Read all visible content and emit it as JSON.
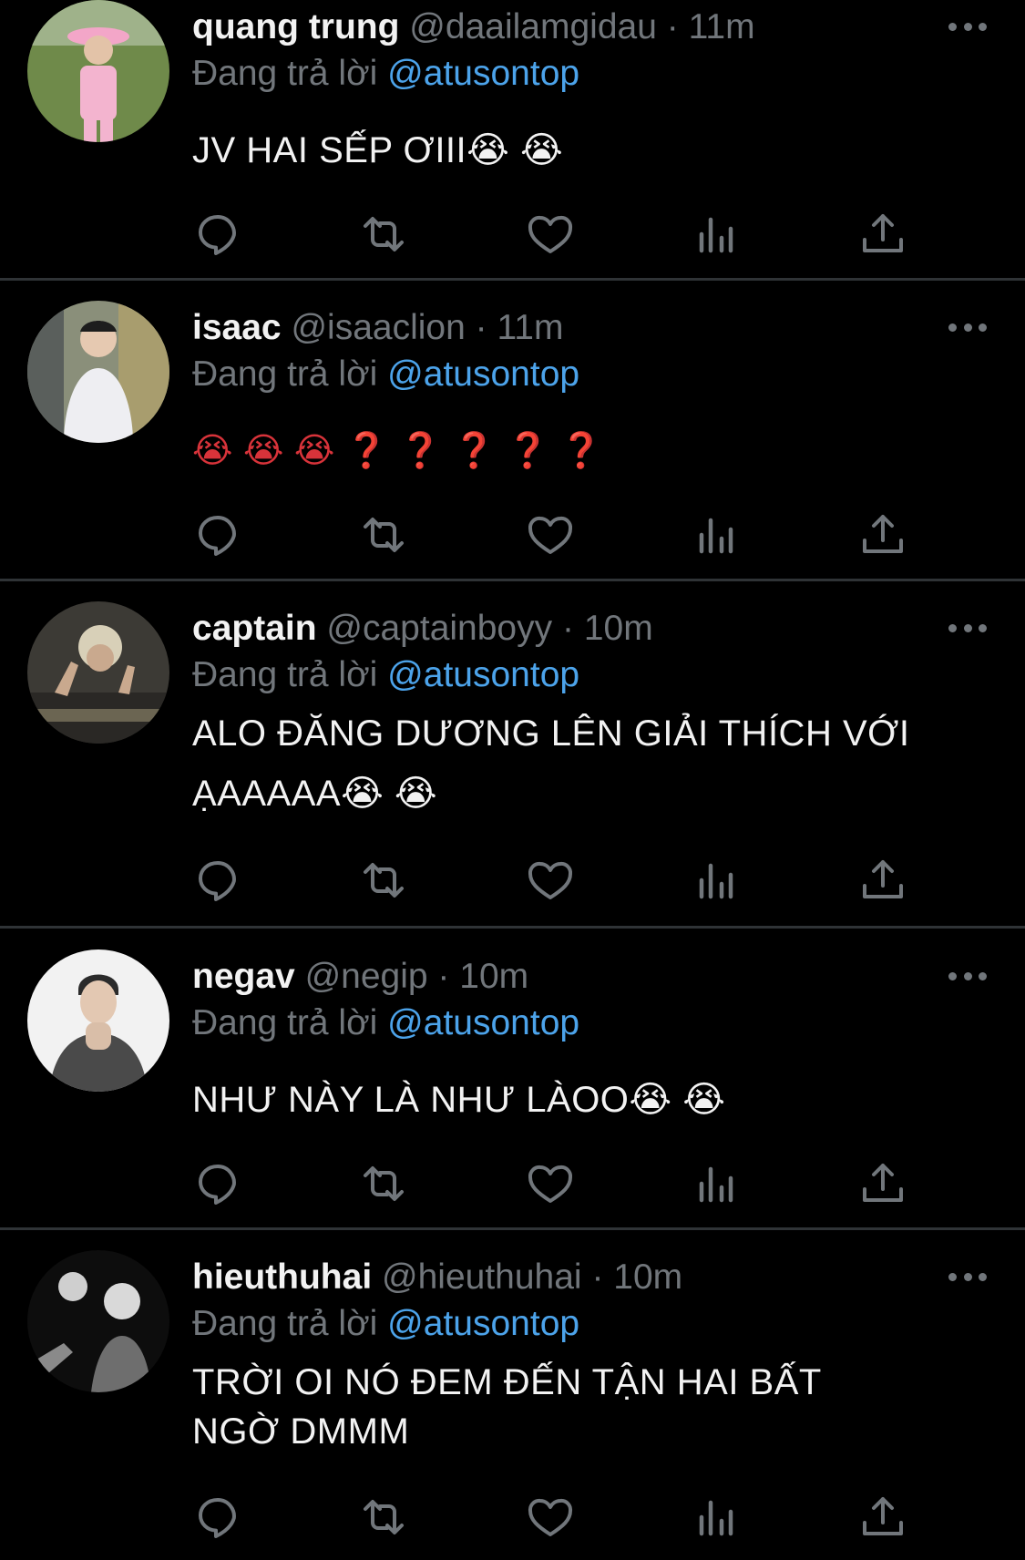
{
  "tweets": [
    {
      "name": "quang trung",
      "handle": "@daailamgidau",
      "time": "11m",
      "reply_label": "Đang trả lời",
      "reply_to": "@atusontop",
      "text": "JV HAI SẾP ƠIII😭 😭",
      "avatar": {
        "bg": "#6f8a4a",
        "accent": "#f3a6c8"
      }
    },
    {
      "name": "isaac",
      "handle": "@isaaclion",
      "time": "11m",
      "reply_label": "Đang trả lời",
      "reply_to": "@atusontop",
      "text": "😭 😭 😭 ❓ ❓ ❓ ❓ ❓",
      "avatar": {
        "bg": "#8a8f7a",
        "accent": "#e9e9ee"
      }
    },
    {
      "name": "captain",
      "handle": "@captainboyy",
      "time": "10m",
      "reply_label": "Đang trả lời",
      "reply_to": "@atusontop",
      "text": "ALO ĐĂNG DƯƠNG LÊN GIẢI THÍCH VỚI ẠAAAAA😭 😭",
      "avatar": {
        "bg": "#3c3a35",
        "accent": "#d8d0b8"
      }
    },
    {
      "name": "negav",
      "handle": "@negip",
      "time": "10m",
      "reply_label": "Đang trả lời",
      "reply_to": "@atusontop",
      "text": "NHƯ NÀY LÀ NHƯ LÀOO😭 😭",
      "avatar": {
        "bg": "#f2f2f2",
        "accent": "#4a4a4a"
      }
    },
    {
      "name": "hieuthuhai",
      "handle": "@hieuthuhai",
      "time": "10m",
      "reply_label": "Đang trả lời",
      "reply_to": "@atusontop",
      "text": "TRỜI OI NÓ ĐEM ĐẾN TẬN HAI BẤT NGỜ DMMM",
      "avatar": {
        "bg": "#0d0d0d",
        "accent": "#cfcfcf"
      }
    }
  ],
  "separator": "·",
  "colors": {
    "background": "#000000",
    "meta": "#71767b",
    "mention": "#4ca3ea",
    "divider": "#2f3336"
  },
  "icons": [
    "reply-icon",
    "retweet-icon",
    "like-icon",
    "views-icon",
    "share-icon",
    "more-icon"
  ]
}
